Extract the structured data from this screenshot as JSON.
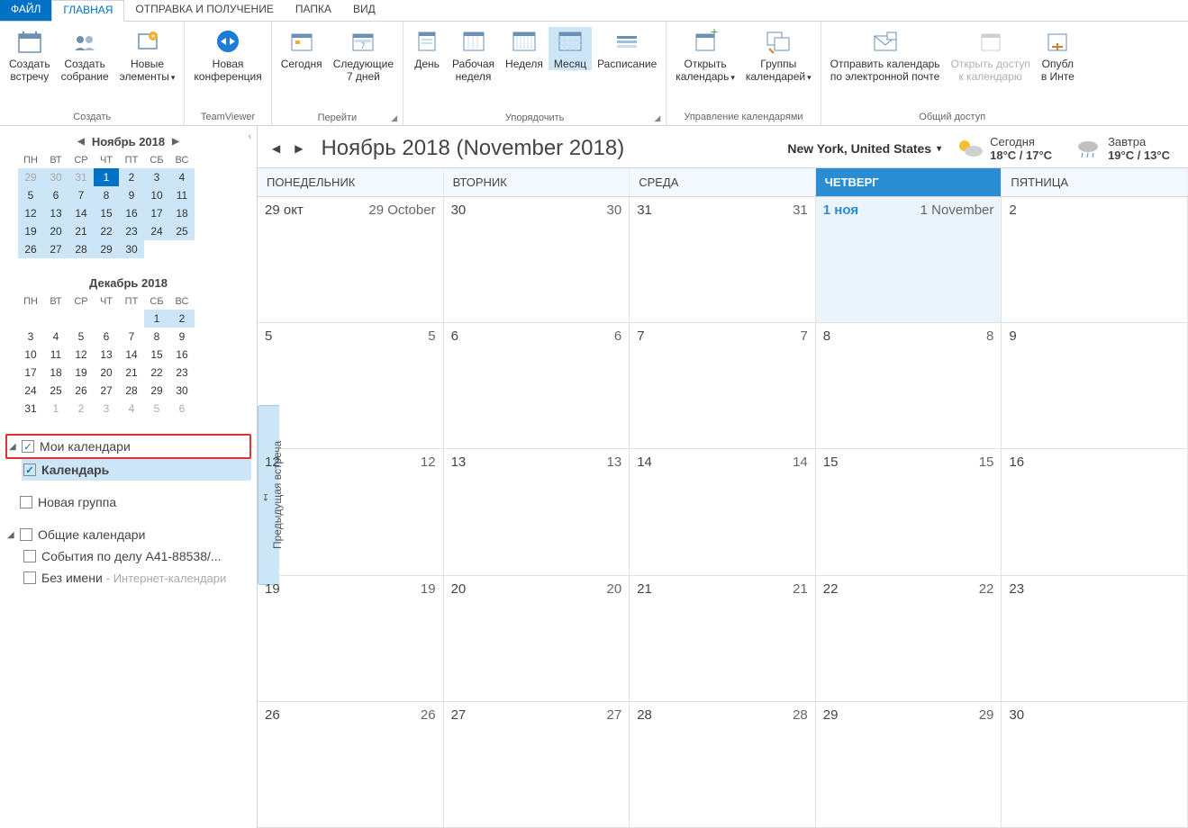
{
  "tabs": {
    "file": "ФАЙЛ",
    "home": "ГЛАВНАЯ",
    "sendrecv": "ОТПРАВКА И ПОЛУЧЕНИЕ",
    "folder": "ПАПКА",
    "view": "ВИД"
  },
  "ribbon": {
    "create": {
      "label": "Создать",
      "new_meeting": "Создать\nвстречу",
      "new_gathering": "Создать\nсобрание",
      "new_items": "Новые\nэлементы"
    },
    "teamviewer": {
      "label": "TeamViewer",
      "new_conf": "Новая\nконференция"
    },
    "goto": {
      "label": "Перейти",
      "today": "Сегодня",
      "next7": "Следующие\n7 дней"
    },
    "arrange": {
      "label": "Упорядочить",
      "day": "День",
      "workweek": "Рабочая\nнеделя",
      "week": "Неделя",
      "month": "Месяц",
      "schedule": "Расписание"
    },
    "manage": {
      "label": "Управление календарями",
      "open_cal": "Открыть\nкалендарь",
      "cal_groups": "Группы\nкалендарей"
    },
    "share": {
      "label": "Общий доступ",
      "send_email": "Отправить календарь\nпо электронной почте",
      "open_access": "Открыть доступ\nк календарю",
      "publish": "Опубл\nв Инте"
    }
  },
  "minical1": {
    "title": "Ноябрь 2018",
    "dow": [
      "ПН",
      "ВТ",
      "СР",
      "ЧТ",
      "ПТ",
      "СБ",
      "ВС"
    ],
    "days": [
      {
        "n": "29",
        "c": "prev hl"
      },
      {
        "n": "30",
        "c": "prev hl"
      },
      {
        "n": "31",
        "c": "prev hl"
      },
      {
        "n": "1",
        "c": "today"
      },
      {
        "n": "2",
        "c": "hl"
      },
      {
        "n": "3",
        "c": "hl"
      },
      {
        "n": "4",
        "c": "hl"
      },
      {
        "n": "5",
        "c": "hl"
      },
      {
        "n": "6",
        "c": "hl"
      },
      {
        "n": "7",
        "c": "hl"
      },
      {
        "n": "8",
        "c": "hl"
      },
      {
        "n": "9",
        "c": "hl"
      },
      {
        "n": "10",
        "c": "hl"
      },
      {
        "n": "11",
        "c": "hl"
      },
      {
        "n": "12",
        "c": "hl"
      },
      {
        "n": "13",
        "c": "hl"
      },
      {
        "n": "14",
        "c": "hl"
      },
      {
        "n": "15",
        "c": "hl"
      },
      {
        "n": "16",
        "c": "hl"
      },
      {
        "n": "17",
        "c": "hl"
      },
      {
        "n": "18",
        "c": "hl"
      },
      {
        "n": "19",
        "c": "hl"
      },
      {
        "n": "20",
        "c": "hl"
      },
      {
        "n": "21",
        "c": "hl"
      },
      {
        "n": "22",
        "c": "hl"
      },
      {
        "n": "23",
        "c": "hl"
      },
      {
        "n": "24",
        "c": "hl"
      },
      {
        "n": "25",
        "c": "hl"
      },
      {
        "n": "26",
        "c": "hl"
      },
      {
        "n": "27",
        "c": "hl"
      },
      {
        "n": "28",
        "c": "hl"
      },
      {
        "n": "29",
        "c": "hl"
      },
      {
        "n": "30",
        "c": "hl"
      },
      {
        "n": "",
        "c": ""
      },
      {
        "n": "",
        "c": ""
      }
    ]
  },
  "minical2": {
    "title": "Декабрь 2018",
    "dow": [
      "ПН",
      "ВТ",
      "СР",
      "ЧТ",
      "ПТ",
      "СБ",
      "ВС"
    ],
    "days": [
      {
        "n": "",
        "c": ""
      },
      {
        "n": "",
        "c": ""
      },
      {
        "n": "",
        "c": ""
      },
      {
        "n": "",
        "c": ""
      },
      {
        "n": "",
        "c": ""
      },
      {
        "n": "1",
        "c": "hl"
      },
      {
        "n": "2",
        "c": "hl"
      },
      {
        "n": "3",
        "c": ""
      },
      {
        "n": "4",
        "c": ""
      },
      {
        "n": "5",
        "c": ""
      },
      {
        "n": "6",
        "c": ""
      },
      {
        "n": "7",
        "c": ""
      },
      {
        "n": "8",
        "c": ""
      },
      {
        "n": "9",
        "c": ""
      },
      {
        "n": "10",
        "c": ""
      },
      {
        "n": "11",
        "c": ""
      },
      {
        "n": "12",
        "c": ""
      },
      {
        "n": "13",
        "c": ""
      },
      {
        "n": "14",
        "c": ""
      },
      {
        "n": "15",
        "c": ""
      },
      {
        "n": "16",
        "c": ""
      },
      {
        "n": "17",
        "c": ""
      },
      {
        "n": "18",
        "c": ""
      },
      {
        "n": "19",
        "c": ""
      },
      {
        "n": "20",
        "c": ""
      },
      {
        "n": "21",
        "c": ""
      },
      {
        "n": "22",
        "c": ""
      },
      {
        "n": "23",
        "c": ""
      },
      {
        "n": "24",
        "c": ""
      },
      {
        "n": "25",
        "c": ""
      },
      {
        "n": "26",
        "c": ""
      },
      {
        "n": "27",
        "c": ""
      },
      {
        "n": "28",
        "c": ""
      },
      {
        "n": "29",
        "c": ""
      },
      {
        "n": "30",
        "c": ""
      },
      {
        "n": "31",
        "c": ""
      },
      {
        "n": "1",
        "c": "next"
      },
      {
        "n": "2",
        "c": "next"
      },
      {
        "n": "3",
        "c": "next"
      },
      {
        "n": "4",
        "c": "next"
      },
      {
        "n": "5",
        "c": "next"
      },
      {
        "n": "6",
        "c": "next"
      }
    ]
  },
  "tree": {
    "my_calendars": "Мои календари",
    "calendar": "Календарь",
    "new_group": "Новая группа",
    "shared": "Общие календари",
    "case": "События по делу А41-88538/...",
    "noname": "Без имени",
    "noname_suffix": "- Интернет-календари"
  },
  "header": {
    "title": "Ноябрь 2018 (November 2018)",
    "location": "New York, United States",
    "today_label": "Сегодня",
    "today_temp": "18°C / 17°C",
    "tomorrow_label": "Завтра",
    "tomorrow_temp": "19°C / 13°C"
  },
  "dow": [
    "ПОНЕДЕЛЬНИК",
    "ВТОРНИК",
    "СРЕДА",
    "ЧЕТВЕРГ",
    "ПЯТНИЦА"
  ],
  "weeks": [
    [
      {
        "l": "29 окт",
        "r": "29 October"
      },
      {
        "l": "30",
        "r": "30"
      },
      {
        "l": "31",
        "r": "31"
      },
      {
        "l": "1 ноя",
        "r": "1 November",
        "today": true
      },
      {
        "l": "2",
        "r": ""
      }
    ],
    [
      {
        "l": "5",
        "r": "5"
      },
      {
        "l": "6",
        "r": "6"
      },
      {
        "l": "7",
        "r": "7"
      },
      {
        "l": "8",
        "r": "8"
      },
      {
        "l": "9",
        "r": ""
      }
    ],
    [
      {
        "l": "12",
        "r": "12"
      },
      {
        "l": "13",
        "r": "13"
      },
      {
        "l": "14",
        "r": "14"
      },
      {
        "l": "15",
        "r": "15"
      },
      {
        "l": "16",
        "r": ""
      }
    ],
    [
      {
        "l": "19",
        "r": "19"
      },
      {
        "l": "20",
        "r": "20"
      },
      {
        "l": "21",
        "r": "21"
      },
      {
        "l": "22",
        "r": "22"
      },
      {
        "l": "23",
        "r": ""
      }
    ],
    [
      {
        "l": "26",
        "r": "26"
      },
      {
        "l": "27",
        "r": "27"
      },
      {
        "l": "28",
        "r": "28"
      },
      {
        "l": "29",
        "r": "29"
      },
      {
        "l": "30",
        "r": ""
      }
    ]
  ],
  "prev_appt": "Предыдущая встреча"
}
